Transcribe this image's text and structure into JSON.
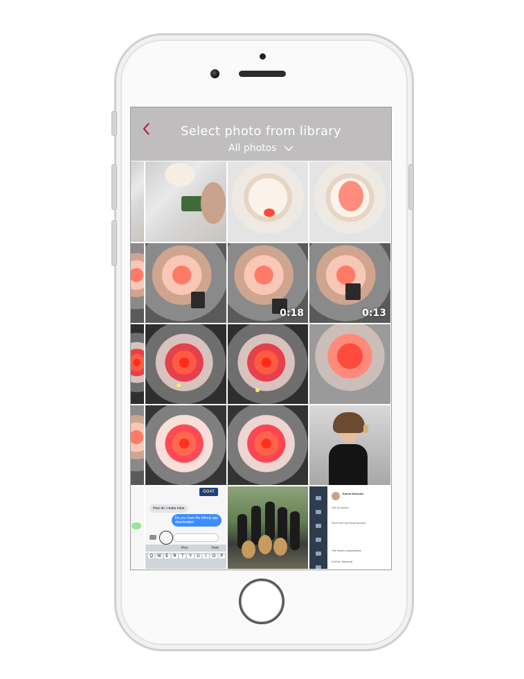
{
  "header": {
    "title": "Select photo from library",
    "album": "All photos",
    "back_icon": "chevron-left-icon",
    "dropdown_icon": "chevron-down-icon",
    "accent_color": "#b2122b",
    "background_color": "#bfbdbd"
  },
  "photos": [
    {
      "kind": "photo",
      "subject": "circuit board build"
    },
    {
      "kind": "photo",
      "subject": "white rose"
    },
    {
      "kind": "photo",
      "subject": "white rose lit"
    },
    {
      "kind": "photo",
      "subject": "rose on stand"
    },
    {
      "kind": "video",
      "duration": "0:18"
    },
    {
      "kind": "video",
      "duration": "0:13"
    },
    {
      "kind": "photo",
      "subject": "red glowing rose"
    },
    {
      "kind": "photo",
      "subject": "red glowing rose"
    },
    {
      "kind": "photo",
      "subject": "red rose close-up"
    },
    {
      "kind": "photo",
      "subject": "glowing rose"
    },
    {
      "kind": "photo",
      "subject": "glowing rose"
    },
    {
      "kind": "photo",
      "subject": "selfie"
    },
    {
      "kind": "screenshot",
      "subject": "messages"
    },
    {
      "kind": "photo",
      "subject": "group with instruments"
    },
    {
      "kind": "screenshot",
      "subject": "course inbox"
    }
  ],
  "messages_screenshot": {
    "banner": "GOAT",
    "received": "How do I make mine",
    "sent": "Do you have the bitmoji app downloaded",
    "quick_replies": [
      "they",
      "Yeah"
    ],
    "keyboard_row": [
      "Q",
      "W",
      "E",
      "R",
      "T",
      "Y",
      "U",
      "I",
      "O",
      "P"
    ]
  },
  "inbox_screenshot": {
    "sender": "Emma Westcott",
    "lines": [
      "Yes of course.",
      "Sent from my email account",
      "The weeks expectations",
      "Hi Prof. Westcott"
    ],
    "nav": [
      "Account",
      "Dashboard",
      "Courses",
      "Groups",
      "Calendar",
      "Inbox"
    ]
  }
}
